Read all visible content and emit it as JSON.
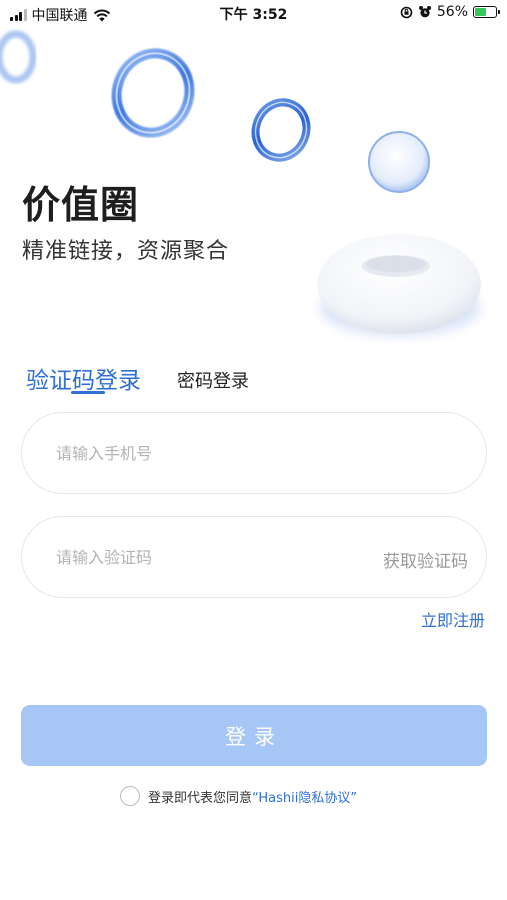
{
  "status_bar": {
    "carrier": "中国联通",
    "time": "下午 3:52",
    "battery": "56%",
    "battery_level": 0.56,
    "icons": [
      "signal-icon",
      "wifi-icon",
      "orientation-lock-icon",
      "alarm-icon",
      "battery-icon",
      "charging-icon"
    ]
  },
  "header": {
    "title": "价值圈",
    "subtitle": "精准链接，资源聚合"
  },
  "tabs": [
    {
      "label": "验证码登录",
      "active": true
    },
    {
      "label": "密码登录",
      "active": false
    }
  ],
  "form": {
    "phone_placeholder": "请输入手机号",
    "phone_value": "",
    "code_placeholder": "请输入验证码",
    "code_value": "",
    "get_code_label": "获取验证码"
  },
  "register_label": "立即注册",
  "login_label": "登录",
  "agreement": {
    "text": "登录即代表您同意",
    "link": "“Hashii隐私协议”",
    "checked": false
  },
  "colors": {
    "accent": "#2f6fd6",
    "login_button": "#a6c6f5",
    "placeholder": "#b3b3b3"
  }
}
